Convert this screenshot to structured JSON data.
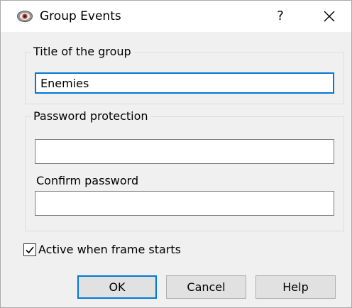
{
  "window": {
    "title": "Group Events",
    "help_label": "?",
    "close_icon": "close-icon",
    "app_icon": "eye-icon"
  },
  "group_title": {
    "legend": "Title of the group",
    "value": "Enemies"
  },
  "password": {
    "legend": "Password protection",
    "value": "",
    "confirm_label": "Confirm password",
    "confirm_value": ""
  },
  "active_checkbox": {
    "label": "Active when frame starts",
    "checked": true
  },
  "buttons": {
    "ok": "OK",
    "cancel": "Cancel",
    "help": "Help"
  },
  "colors": {
    "accent": "#0078d7",
    "dialog_background": "#f0f0f0",
    "titlebar_background": "#ffffff"
  }
}
